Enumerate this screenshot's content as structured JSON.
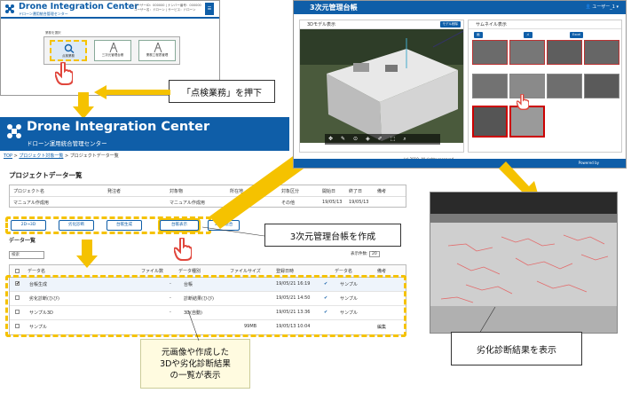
{
  "top_left": {
    "app_title": "Drone Integration Center",
    "subtitle": "ドローン運用統合管理センター",
    "header_info": [
      "ユーザーID：000000 | ナンバー番号：000000",
      "ユーザー名：ドローン | サービス：ドローン"
    ],
    "tile_caption": "業務を選択",
    "tiles": [
      "点検業務",
      "三次元管理台帳",
      "業務工程表管理"
    ]
  },
  "callouts": {
    "press_inspection": "「点検業務」を押下",
    "create_ledger": "3次元管理台帳を作成",
    "list_shown_1": "元画像や作成した",
    "list_shown_2": "3Dや劣化診断結果",
    "list_shown_3": "の一覧が表示",
    "show_result": "劣化診断結果を表示"
  },
  "main": {
    "banner_title": "Drone Integration Center",
    "banner_sub": "ドローン運用統合管理センター",
    "breadcrumb": [
      "TOP",
      "プロジェクト対象一覧",
      "プロジェクトデータ一覧"
    ],
    "page_title": "プロジェクトデータ一覧",
    "project_headers": [
      "プロジェクト名",
      "発注者",
      "対象物",
      "所在地",
      "対象区分",
      "開始日",
      "終了日",
      "備考"
    ],
    "project_row": [
      "マニュアル作成用",
      "",
      "マニュアル作成用",
      "",
      "その他",
      "19/05/13",
      "19/05/13",
      ""
    ],
    "action_buttons": [
      "2D→3D",
      "劣化診断",
      "台帳生成",
      "台帳表示",
      "3次元統合"
    ],
    "data_title": "データ一覧",
    "search_value": "検索",
    "count_label": "表示件数:",
    "count_value": "20",
    "data_headers": [
      "データ名",
      "ファイル数",
      "データ種別",
      "ファイルサイズ",
      "登録日時",
      "",
      "データ名",
      "備考"
    ],
    "rows": [
      {
        "check": "✔",
        "name": "台帳生成",
        "files": "-",
        "kind": "台帳",
        "size": "",
        "date": "19/05/21 16:19",
        "mark": "✔",
        "sample": "サンプル"
      },
      {
        "check": "",
        "name": "劣化診断(ひび)",
        "files": "-",
        "kind": "診断結果(ひび)",
        "size": "",
        "date": "19/05/21 14:50",
        "mark": "✔",
        "sample": "サンプル"
      },
      {
        "check": "",
        "name": "サンプル3D",
        "files": "-",
        "kind": "3D(自動)",
        "size": "",
        "date": "19/05/21 13:36",
        "mark": "✔",
        "sample": "サンプル"
      },
      {
        "check": "",
        "name": "サンプル",
        "files": "",
        "kind": "",
        "size": "99MB",
        "date": "19/05/13 10:04",
        "mark": "",
        "sample": "編集"
      }
    ]
  },
  "top_right": {
    "title": "3次元管理台帳",
    "user": "ユーザー_1",
    "panel_3d": "3Dモデル表示",
    "panel_3d_btn": "モデル削除",
    "panel_thumb": "サムネイル表示",
    "thumb_btns": [
      "画像登録画面",
      "メタデータ表示",
      "Excelレポート出力"
    ],
    "copyright": "(c) 2019. All rights reserved.",
    "powered": "Powered by"
  },
  "colors": {
    "brand_blue": "#0f5ea8",
    "arrow_yellow": "#f5c200",
    "hand_red": "#e0463c"
  }
}
